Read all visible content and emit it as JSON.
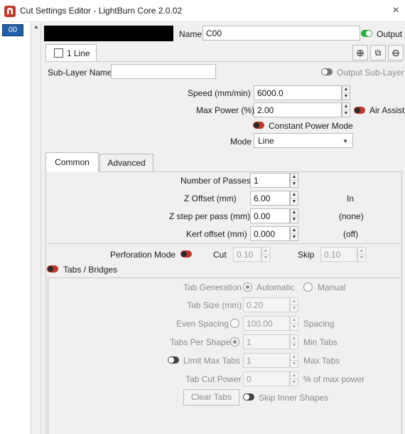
{
  "window": {
    "title": "Cut Settings Editor - LightBurn Core 2.0.02",
    "close_icon": "×"
  },
  "layers": {
    "selected_chip": "00"
  },
  "header": {
    "layer_color": "#000000",
    "name_label": "Name",
    "name_value": "C00",
    "output_label": "Output"
  },
  "sublayer_tabs": {
    "tab_label": "1 Line",
    "add_icon": "⊕",
    "copy_icon": "⧉",
    "remove_icon": "⊖"
  },
  "sublayer": {
    "name_label": "Sub-Layer Name",
    "name_value": "",
    "output_sublayer_label": "Output Sub-Layer"
  },
  "power": {
    "speed_label": "Speed (mm/min)",
    "speed_value": "6000.0",
    "max_power_label": "Max Power (%)",
    "max_power_value": "2.00",
    "air_assist_label": "Air Assist",
    "constant_power_label": "Constant Power Mode",
    "mode_label": "Mode",
    "mode_value": "Line"
  },
  "settings_tabs": {
    "common": "Common",
    "advanced": "Advanced"
  },
  "common": {
    "passes_label": "Number of Passes",
    "passes_value": "1",
    "z_offset_label": "Z Offset (mm)",
    "z_offset_value": "6.00",
    "z_offset_note": "In",
    "z_step_label": "Z step per pass (mm)",
    "z_step_value": "0.00",
    "z_step_note": "(none)",
    "kerf_label": "Kerf offset (mm)",
    "kerf_value": "0.000",
    "kerf_note": "(off)",
    "perforation_label": "Perforation Mode",
    "cut_label": "Cut",
    "cut_value": "0.10",
    "skip_label": "Skip",
    "skip_value": "0.10",
    "tabs_bridges_label": "Tabs / Bridges"
  },
  "tabs": {
    "generation_label": "Tab Generation",
    "automatic_label": "Automatic",
    "manual_label": "Manual",
    "size_label": "Tab Size (mm)",
    "size_value": "0.20",
    "even_spacing_label": "Even Spacing",
    "even_spacing_value": "100.00",
    "spacing_label": "Spacing",
    "per_shape_label": "Tabs Per Shape",
    "per_shape_value": "1",
    "min_tabs_label": "Min Tabs",
    "limit_max_label": "Limit Max Tabs",
    "limit_max_value": "1",
    "max_tabs_label": "Max Tabs",
    "cut_power_label": "Tab Cut Power",
    "cut_power_value": "0",
    "cut_power_unit": "% of max power",
    "clear_tabs_label": "Clear Tabs",
    "skip_inner_label": "Skip Inner Shapes"
  },
  "colors": {
    "accent": "#1f5fa8",
    "toggle_on": "#27ae3b",
    "toggle_red": "#c0392b"
  }
}
